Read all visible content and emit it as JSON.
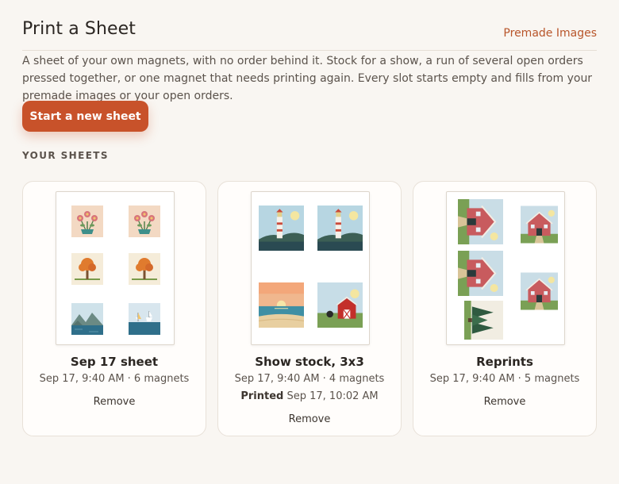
{
  "header": {
    "title": "Print a Sheet",
    "premade_link": "Premade Images"
  },
  "intro": "A sheet of your own magnets, with no order behind it. Stock for a show, a run of several open orders pressed together, or one magnet that needs printing again. Every slot starts empty and fills from your premade images or your open orders.",
  "start_button": "Start a new sheet",
  "section_label": "YOUR SHEETS",
  "sheets": [
    {
      "title": "Sep 17 sheet",
      "meta": "Sep 17, 9:40 AM · 6 magnets",
      "remove": "Remove",
      "thumbnails": [
        "flower-pot",
        "flower-pot",
        "autumn-tree",
        "autumn-tree",
        "mountain-lake",
        "sailboats"
      ]
    },
    {
      "title": "Show stock, 3x3",
      "meta": "Sep 17, 9:40 AM · 4 magnets",
      "printed_label": "Printed",
      "printed_value": "Sep 17, 10:02 AM",
      "remove": "Remove",
      "thumbnails": [
        "lighthouse",
        "lighthouse",
        "beach-sunset",
        "red-barn"
      ]
    },
    {
      "title": "Reprints",
      "meta": "Sep 17, 9:40 AM · 5 magnets",
      "remove": "Remove",
      "thumbnails": [
        "red-house-rotated",
        "red-house",
        "red-house-rotated",
        "red-house",
        "pine-trees-rotated"
      ]
    }
  ]
}
